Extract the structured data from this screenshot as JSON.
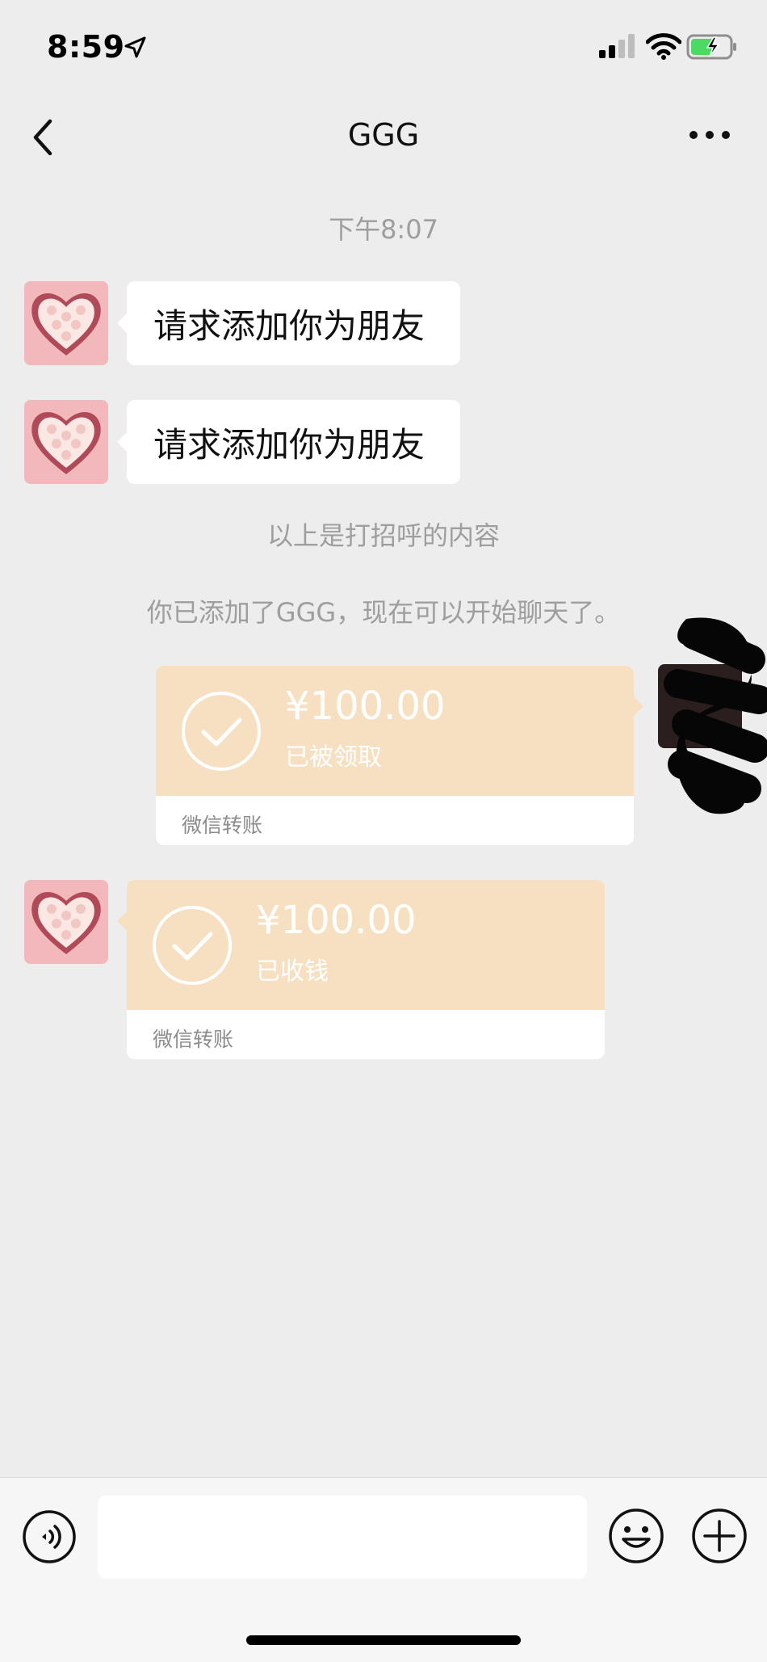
{
  "status_bar": {
    "time": "8:59",
    "location_icon": "location-arrow-icon",
    "signal_icon": "cellular-signal-icon",
    "wifi_icon": "wifi-icon",
    "battery_icon": "battery-charging-icon"
  },
  "nav": {
    "title": "GGG",
    "back_icon": "chevron-left-icon",
    "more_icon": "more-dots-icon"
  },
  "chat": {
    "timestamp": "下午8:07",
    "messages": [
      {
        "sender": "contact",
        "type": "text",
        "text": "请求添加你为朋友"
      },
      {
        "sender": "contact",
        "type": "text",
        "text": "请求添加你为朋友"
      }
    ],
    "system_notes": [
      "以上是打招呼的内容",
      "你已添加了GGG，现在可以开始聊天了。"
    ],
    "transfers": [
      {
        "sender": "self",
        "amount": "¥100.00",
        "status": "已被领取",
        "label": "微信转账"
      },
      {
        "sender": "contact",
        "amount": "¥100.00",
        "status": "已收钱",
        "label": "微信转账"
      }
    ]
  },
  "input_bar": {
    "voice_icon": "voice-input-icon",
    "emoji_icon": "emoji-icon",
    "plus_icon": "plus-circle-icon",
    "placeholder": ""
  },
  "colors": {
    "background": "#ededed",
    "transfer_bg": "#f7e0c1",
    "bubble_bg": "#ffffff",
    "system_text": "#9e9e9e"
  }
}
